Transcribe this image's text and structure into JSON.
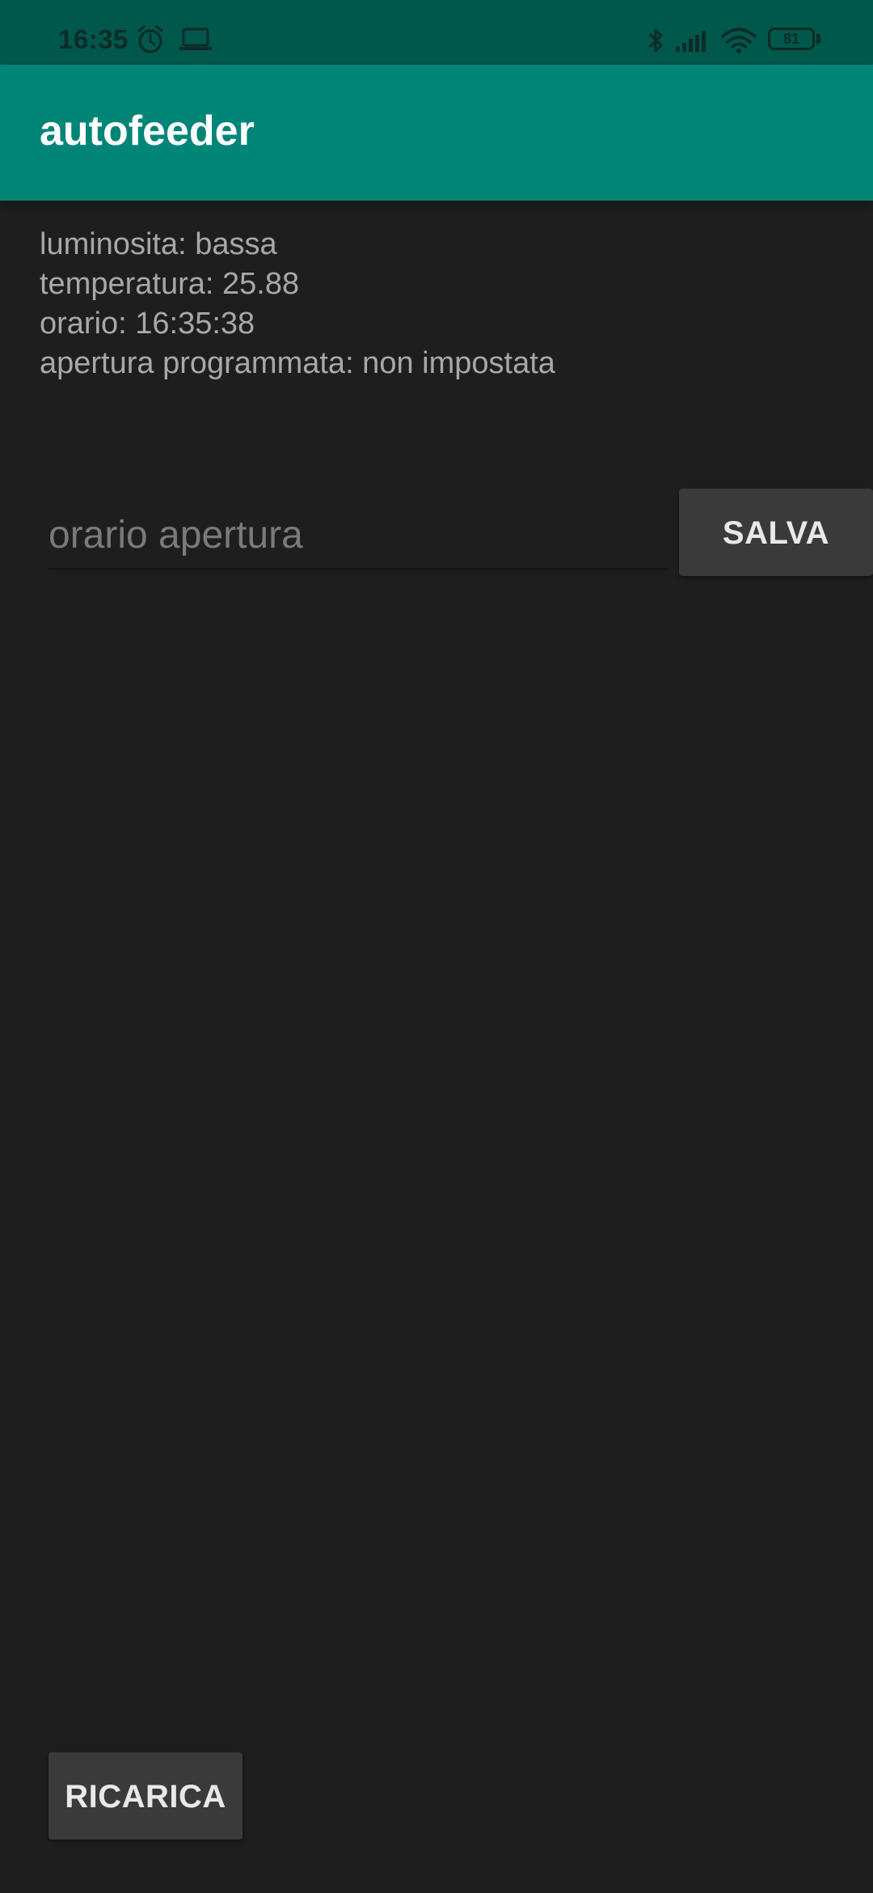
{
  "status_bar": {
    "time": "16:35",
    "battery": "81",
    "icons": [
      "alarm-icon",
      "laptop-icon",
      "bluetooth-icon",
      "signal-icon",
      "wifi-icon",
      "battery-icon"
    ]
  },
  "app_bar": {
    "title": "autofeeder"
  },
  "info": {
    "luminosita": "luminosita: bassa",
    "temperatura": "temperatura: 25.88",
    "orario": "orario: 16:35:38",
    "apertura": "apertura programmata: non impostata"
  },
  "form": {
    "input_placeholder": "orario apertura",
    "input_value": "",
    "save_label": "SALVA"
  },
  "footer": {
    "reload_label": "RICARICA"
  },
  "colors": {
    "status_bar": "#00574b",
    "app_bar": "#008577",
    "background": "#1e1e1e",
    "button": "#3a3a3a"
  }
}
